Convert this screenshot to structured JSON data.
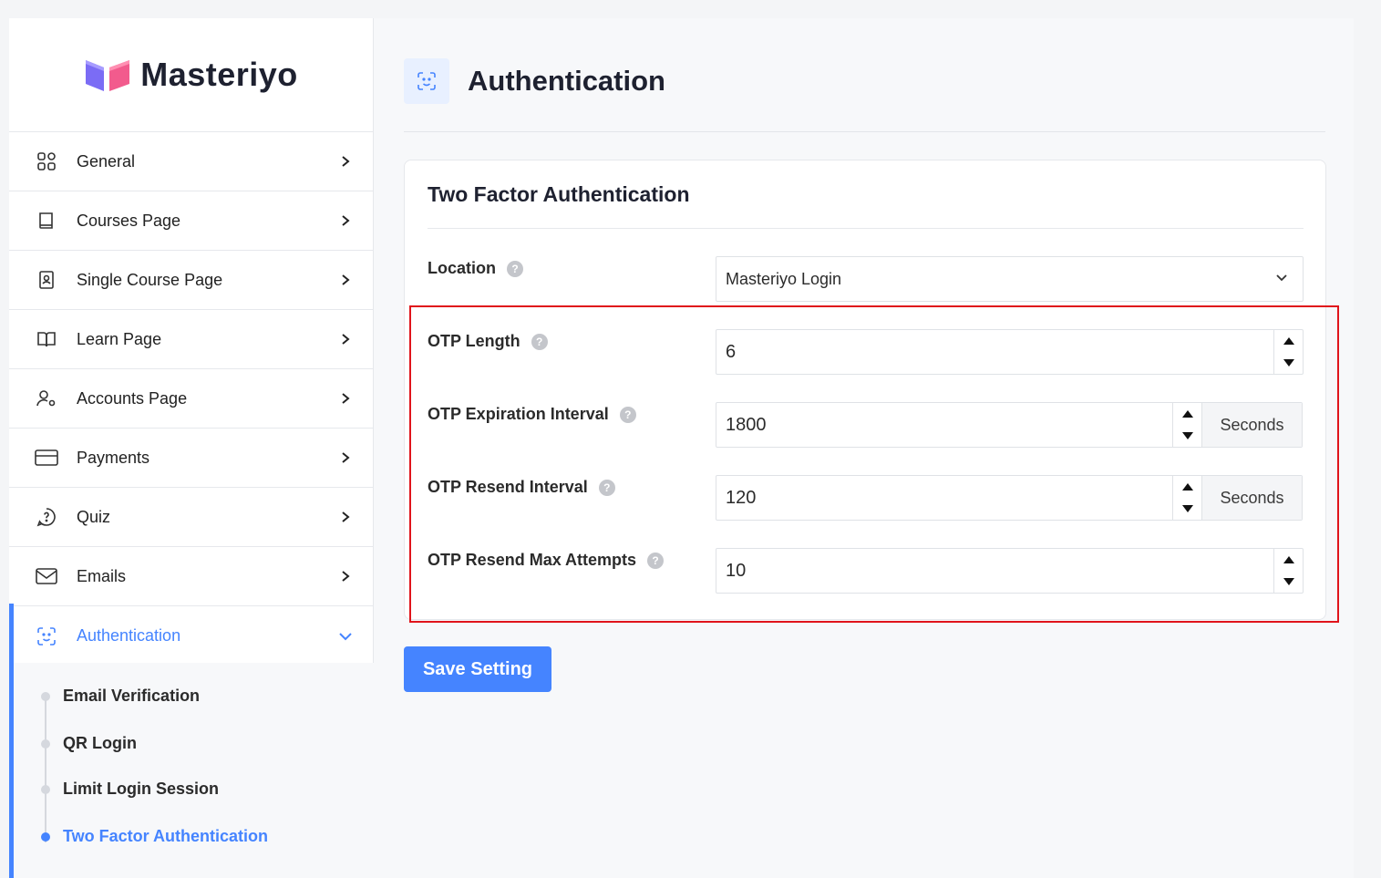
{
  "brand": {
    "name": "Masteriyo"
  },
  "sidebar": {
    "items": [
      {
        "label": "General",
        "icon": "grid-icon"
      },
      {
        "label": "Courses Page",
        "icon": "book-icon"
      },
      {
        "label": "Single Course Page",
        "icon": "portrait-book-icon"
      },
      {
        "label": "Learn Page",
        "icon": "open-book-icon"
      },
      {
        "label": "Accounts Page",
        "icon": "user-gear-icon"
      },
      {
        "label": "Payments",
        "icon": "credit-card-icon"
      },
      {
        "label": "Quiz",
        "icon": "question-bubble-icon"
      },
      {
        "label": "Emails",
        "icon": "mail-icon"
      },
      {
        "label": "Authentication",
        "icon": "face-scan-icon"
      }
    ],
    "sub_items": [
      {
        "label": "Email Verification"
      },
      {
        "label": "QR Login"
      },
      {
        "label": "Limit Login Session"
      },
      {
        "label": "Two Factor Authentication"
      }
    ]
  },
  "page": {
    "title": "Authentication"
  },
  "card": {
    "title": "Two Factor Authentication",
    "location": {
      "label": "Location",
      "value": "Masteriyo Login"
    },
    "otp_length": {
      "label": "OTP Length",
      "value": "6"
    },
    "otp_expiration": {
      "label": "OTP Expiration Interval",
      "value": "1800",
      "unit": "Seconds"
    },
    "otp_resend": {
      "label": "OTP Resend Interval",
      "value": "120",
      "unit": "Seconds"
    },
    "otp_max_attempts": {
      "label": "OTP Resend Max Attempts",
      "value": "10"
    }
  },
  "actions": {
    "save_label": "Save Setting"
  },
  "colors": {
    "accent": "#4584ff",
    "highlight": "#e0141b"
  }
}
